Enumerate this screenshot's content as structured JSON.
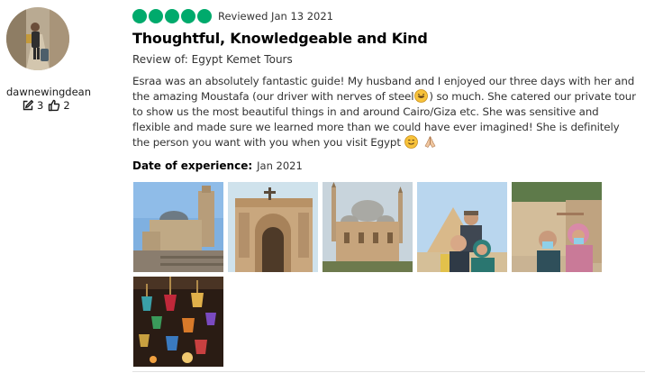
{
  "reviewer": {
    "username": "dawnewingdean",
    "contributions": "3",
    "helpful_votes": "2"
  },
  "review": {
    "bubble_rating": 5,
    "reviewed_date": "Reviewed Jan 13 2021",
    "title": "Thoughtful, Knowledgeable and Kind",
    "review_of": "Review of: Egypt Kemet Tours",
    "body_part1": "Esraa was an absolutely fantastic guide! My husband and I enjoyed our three days with her and the amazing Moustafa (our driver with nerves of steel",
    "body_part2": ") so much. She catered our private tour to show us the most beautiful things in and around Cairo/Giza etc. She was sensitive and flexible and made sure we learned more than we could have ever imagined! She is definitely the person you want with you when you visit Egypt ",
    "date_of_experience_label": "Date of experience:",
    "date_of_experience_value": "Jan 2021"
  },
  "colors": {
    "bubble_green": "#00aa6c"
  },
  "icons": {
    "contributions": "pencil-edit-icon",
    "helpful": "thumbs-up-icon"
  }
}
